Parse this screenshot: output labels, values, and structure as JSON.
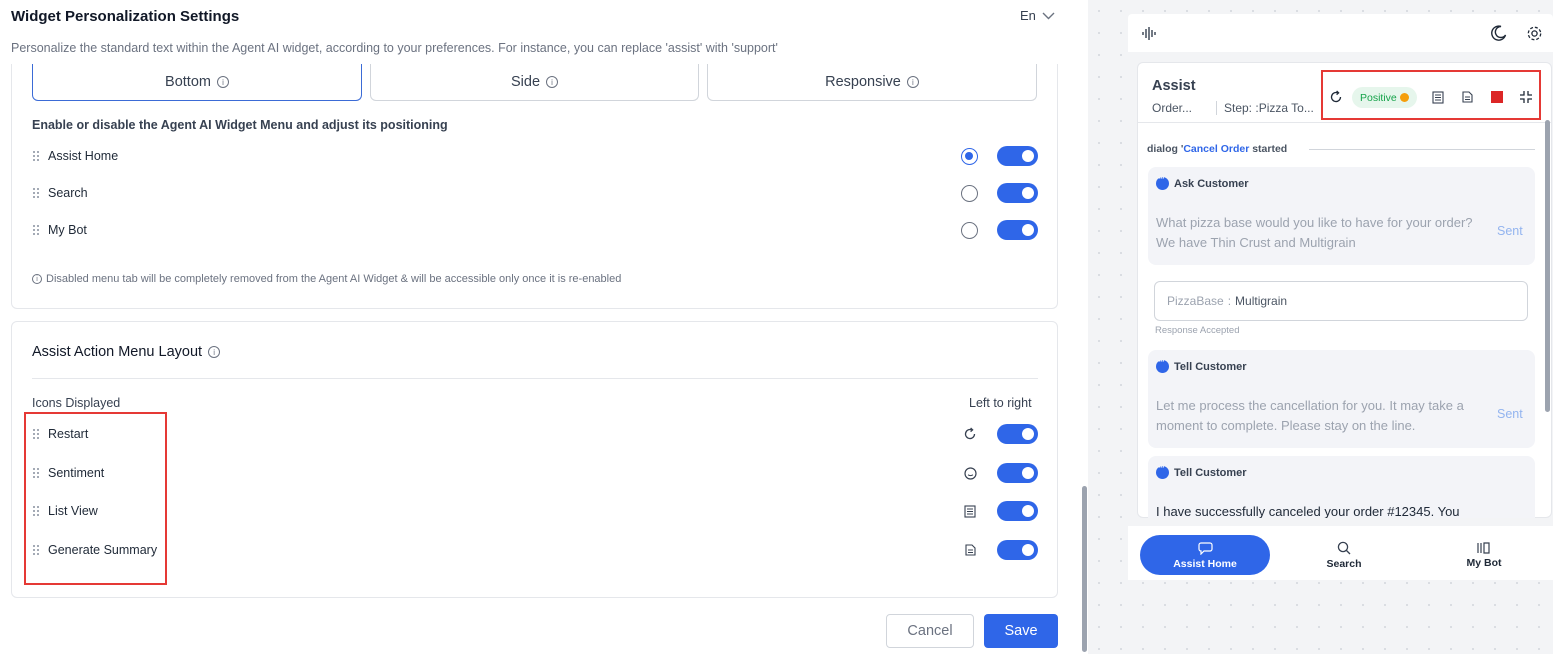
{
  "page": {
    "title": "Widget Personalization Settings",
    "language": "En",
    "subtitle": "Personalize the standard text within the Agent AI widget, according to your preferences. For instance, you can replace 'assist' with 'support'"
  },
  "layout_tabs": [
    {
      "label": "Bottom",
      "active": true
    },
    {
      "label": "Side",
      "active": false
    },
    {
      "label": "Responsive",
      "active": false
    }
  ],
  "menu_section": {
    "label": "Enable or disable the Agent AI Widget Menu and adjust its positioning",
    "items": [
      {
        "label": "Assist Home",
        "default": true,
        "enabled": true
      },
      {
        "label": "Search",
        "default": false,
        "enabled": true
      },
      {
        "label": "My Bot",
        "default": false,
        "enabled": true
      }
    ],
    "note": "Disabled menu tab will be completely removed from the Agent AI Widget & will be accessible only once it is re-enabled"
  },
  "action_menu": {
    "title": "Assist Action Menu Layout",
    "icons_label": "Icons Displayed",
    "order_label": "Left to right",
    "items": [
      {
        "label": "Restart",
        "icon": "restart-icon",
        "enabled": true
      },
      {
        "label": "Sentiment",
        "icon": "sentiment-icon",
        "enabled": true
      },
      {
        "label": "List View",
        "icon": "list-view-icon",
        "enabled": true
      },
      {
        "label": "Generate Summary",
        "icon": "summary-icon",
        "enabled": true
      }
    ]
  },
  "buttons": {
    "cancel": "Cancel",
    "save": "Save"
  },
  "widget": {
    "assist_title": "Assist",
    "sub_left": "Order...",
    "sub_right": "Step: :Pizza To...",
    "sentiment": "Positive",
    "dialog_prefix": "dialog '",
    "dialog_name": "Cancel Order",
    "dialog_suffix": " started",
    "messages": {
      "ask": {
        "head": "Ask Customer",
        "text": "What pizza base would you like to have for your order? We have Thin Crust and Multigrain",
        "status": "Sent"
      },
      "tell1": {
        "head": "Tell Customer",
        "text": "Let me process the cancellation for you. It may take a moment to complete. Please stay on the line.",
        "status": "Sent"
      },
      "tell2": {
        "head": "Tell Customer",
        "text": "I have successfully canceled your order #12345. You"
      }
    },
    "response": {
      "key": "PizzaBase",
      "separator": ":",
      "value": "Multigrain",
      "status": "Response Accepted"
    },
    "nav": [
      {
        "label": "Assist Home",
        "icon": "chat-icon",
        "active": true
      },
      {
        "label": "Search",
        "icon": "search-icon",
        "active": false
      },
      {
        "label": "My Bot",
        "icon": "bot-icon",
        "active": false
      }
    ]
  },
  "colors": {
    "accent": "#2f66e8",
    "highlight": "#e53935",
    "positive": "#16a34a",
    "stop": "#dc2626"
  }
}
